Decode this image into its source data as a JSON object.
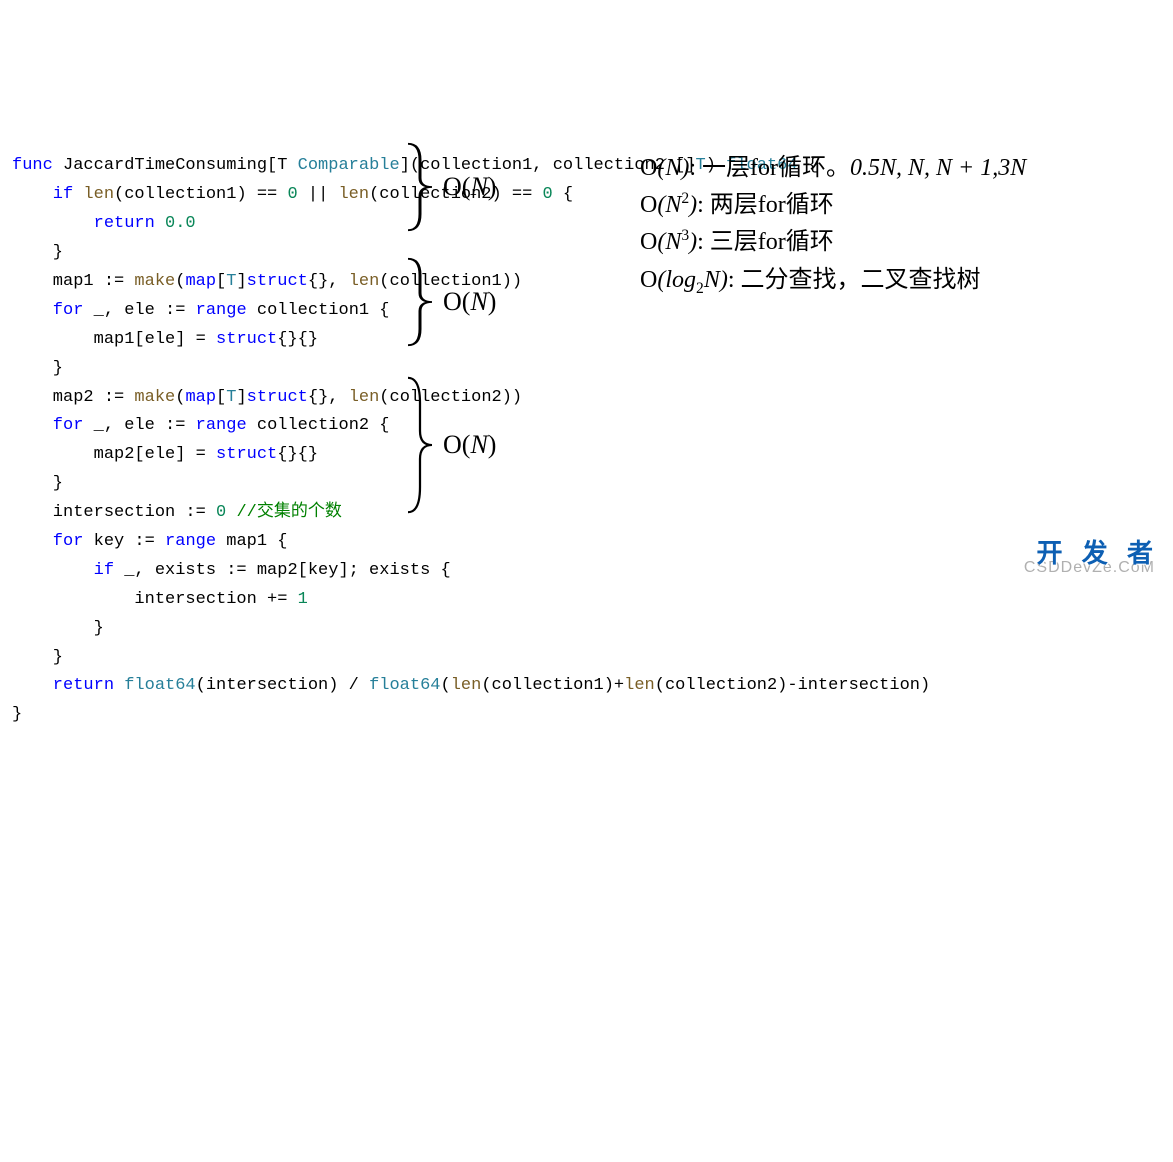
{
  "code": {
    "l1_kw_func": "func",
    "l1_name": " JaccardTimeConsuming[T ",
    "l1_comparable": "Comparable",
    "l1_params": "](collection1, collection2 []",
    "l1_T": "T",
    "l1_ret": ") ",
    "l1_float64": "float64",
    "l1_brace": " {",
    "l2_if": "    if ",
    "l2_len1": "len",
    "l2_mid1": "(collection1) == ",
    "l2_zero1": "0",
    "l2_or": " || ",
    "l2_len2": "len",
    "l2_mid2": "(collection2) == ",
    "l2_zero2": "0",
    "l2_brace": " {",
    "l3_return": "        return ",
    "l3_val": "0.0",
    "l4": "    }",
    "l5_pre": "    map1 := ",
    "l5_make": "make",
    "l5_open": "(",
    "l5_map": "map",
    "l5_bracket": "[",
    "l5_T": "T",
    "l5_close_br": "]",
    "l5_struct": "struct",
    "l5_braces": "{}, ",
    "l5_len": "len",
    "l5_end": "(collection1))",
    "l6_for": "    for ",
    "l6_mid": "_, ele := ",
    "l6_range": "range",
    "l6_end": " collection1 {",
    "l7_pre": "        map1[ele] = ",
    "l7_struct": "struct",
    "l7_end": "{}{}",
    "l8": "    }",
    "l9_pre": "    map2 := ",
    "l9_make": "make",
    "l9_open": "(",
    "l9_map": "map",
    "l9_bracket": "[",
    "l9_T": "T",
    "l9_close_br": "]",
    "l9_struct": "struct",
    "l9_braces": "{}, ",
    "l9_len": "len",
    "l9_end": "(collection2))",
    "l10_for": "    for ",
    "l10_mid": "_, ele := ",
    "l10_range": "range",
    "l10_end": " collection2 {",
    "l11_pre": "        map2[ele] = ",
    "l11_struct": "struct",
    "l11_end": "{}{}",
    "l12": "    }",
    "l13_pre": "    intersection := ",
    "l13_zero": "0",
    "l13_sp": " ",
    "l13_comment": "//交集的个数",
    "l14_for": "    for ",
    "l14_mid": "key := ",
    "l14_range": "range",
    "l14_end": " map1 {",
    "l15_if": "        if ",
    "l15_end": "_, exists := map2[key]; exists {",
    "l16_pre": "            intersection += ",
    "l16_one": "1",
    "l17": "        }",
    "l18": "    }",
    "l19_return": "    return ",
    "l19_float1": "float64",
    "l19_mid1": "(intersection) / ",
    "l19_float2": "float64",
    "l19_mid2": "(",
    "l19_len1": "len",
    "l19_mid3": "(collection1)+",
    "l19_len2": "len",
    "l19_mid4": "(collection2)-intersection)",
    "l20": "}"
  },
  "annot": {
    "on1": "O(N)",
    "on2": "O(N)",
    "on3": "O(N)"
  },
  "notes": {
    "r1_pre": "O(N)",
    "r1_text": ": 一层for循环。",
    "r1_tail": "0.5N, N, N + 1,3N",
    "r2_pre": "O(N",
    "r2_sup": "2",
    "r2_close": ")",
    "r2_text": ": 两层for循环",
    "r3_pre": "O(N",
    "r3_sup": "3",
    "r3_close": ")",
    "r3_text": ": 三层for循环",
    "r4_pre": "O(log",
    "r4_sub": "2",
    "r4_mid": "N)",
    "r4_text": ": 二分查找，二叉查找树"
  },
  "watermark": {
    "main": "开 发 者",
    "sub": "CSDDevZe.CoM"
  }
}
